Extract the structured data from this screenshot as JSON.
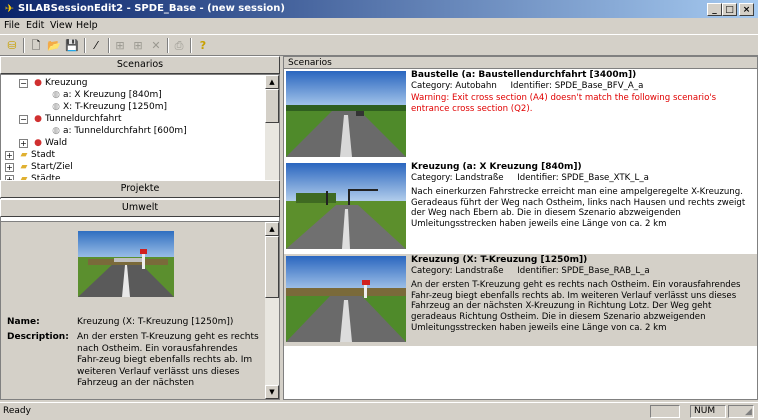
{
  "window": {
    "title": "SILABSessionEdit2 - SPDE_Base - (new session)",
    "minimize": "_",
    "maximize": "□",
    "close": "×"
  },
  "menu": {
    "items": [
      "File",
      "Edit",
      "View",
      "Help"
    ]
  },
  "left": {
    "scenarios_button": "Scenarios",
    "tree": [
      {
        "label": "Kreuzung",
        "level": 1,
        "expander": "−",
        "icon": "scenario-group-icon"
      },
      {
        "label": "a: X Kreuzung [840m]",
        "level": 2,
        "icon": "scenario-icon"
      },
      {
        "label": "X: T-Kreuzung [1250m]",
        "level": 2,
        "icon": "scenario-icon"
      },
      {
        "label": "Tunneldurchfahrt",
        "level": 1,
        "expander": "−",
        "icon": "scenario-group-icon"
      },
      {
        "label": "a: Tunneldurchfahrt [600m]",
        "level": 2,
        "icon": "scenario-icon"
      },
      {
        "label": "Wald",
        "level": 1,
        "expander": "+",
        "icon": "scenario-group-icon"
      },
      {
        "label": "Stadt",
        "level": 0,
        "expander": "+",
        "icon": "folder-icon"
      },
      {
        "label": "Start/Ziel",
        "level": 0,
        "expander": "+",
        "icon": "folder-icon"
      },
      {
        "label": "Städte",
        "level": 0,
        "expander": "+",
        "icon": "folder-icon"
      }
    ],
    "projekte_button": "Projekte",
    "umwelt_button": "Umwelt",
    "detail": {
      "name_label": "Name:",
      "name_value": "Kreuzung (X: T-Kreuzung [1250m])",
      "desc_label": "Description:",
      "desc_value": "An der ersten T-Kreuzung geht es rechts nach Ostheim. Ein vorausfahrendes Fahr-zeug biegt ebenfalls rechts ab. Im weiteren Verlauf verlässt uns dieses Fahrzeug an der nächsten"
    }
  },
  "right": {
    "header": "Scenarios",
    "items": [
      {
        "title": "Baustelle (a: Baustellendurchfahrt [3400m])",
        "category": "Category: Autobahn",
        "identifier": "Identifier: SPDE_Base_BFV_A_a",
        "warning": "Warning: Exit cross section (A4) doesn't match the following scenario's entrance cross section (Q2).",
        "description": "",
        "selected": false
      },
      {
        "title": "Kreuzung (a: X Kreuzung [840m])",
        "category": "Category: Landstraße",
        "identifier": "Identifier: SPDE_Base_XTK_L_a",
        "warning": "",
        "description": "Nach einerkurzen Fahrstrecke erreicht man eine ampelgeregelte X-Kreuzung. Geradeaus führt der Weg nach Ostheim, links nach Hausen und rechts zweigt der Weg nach Ebern ab. Die in diesem Szenario abzweigenden Umleitungsstrecken haben jeweils eine Länge von ca. 2 km",
        "selected": false
      },
      {
        "title": "Kreuzung (X: T-Kreuzung [1250m])",
        "category": "Category: Landstraße",
        "identifier": "Identifier: SPDE_Base_RAB_L_a",
        "warning": "",
        "description": "An der ersten T-Kreuzung geht es rechts nach Ostheim. Ein vorausfahrendes Fahr-zeug biegt ebenfalls rechts ab. Im weiteren Verlauf verlässt uns dieses Fahrzeug an der nächsten X-Kreuzung in Richtung Lotz. Der Weg geht geradeaus Richtung Ostheim. Die in diesem Szenario abzweigenden Umleitungsstrecken haben jeweils eine Länge von ca. 2 km",
        "selected": true
      }
    ]
  },
  "status": {
    "text": "Ready",
    "num": "NUM"
  },
  "colors": {
    "title_start": "#0a246a",
    "title_end": "#a6caf0",
    "warning": "#e00000",
    "selection": "#d4d0c8"
  }
}
